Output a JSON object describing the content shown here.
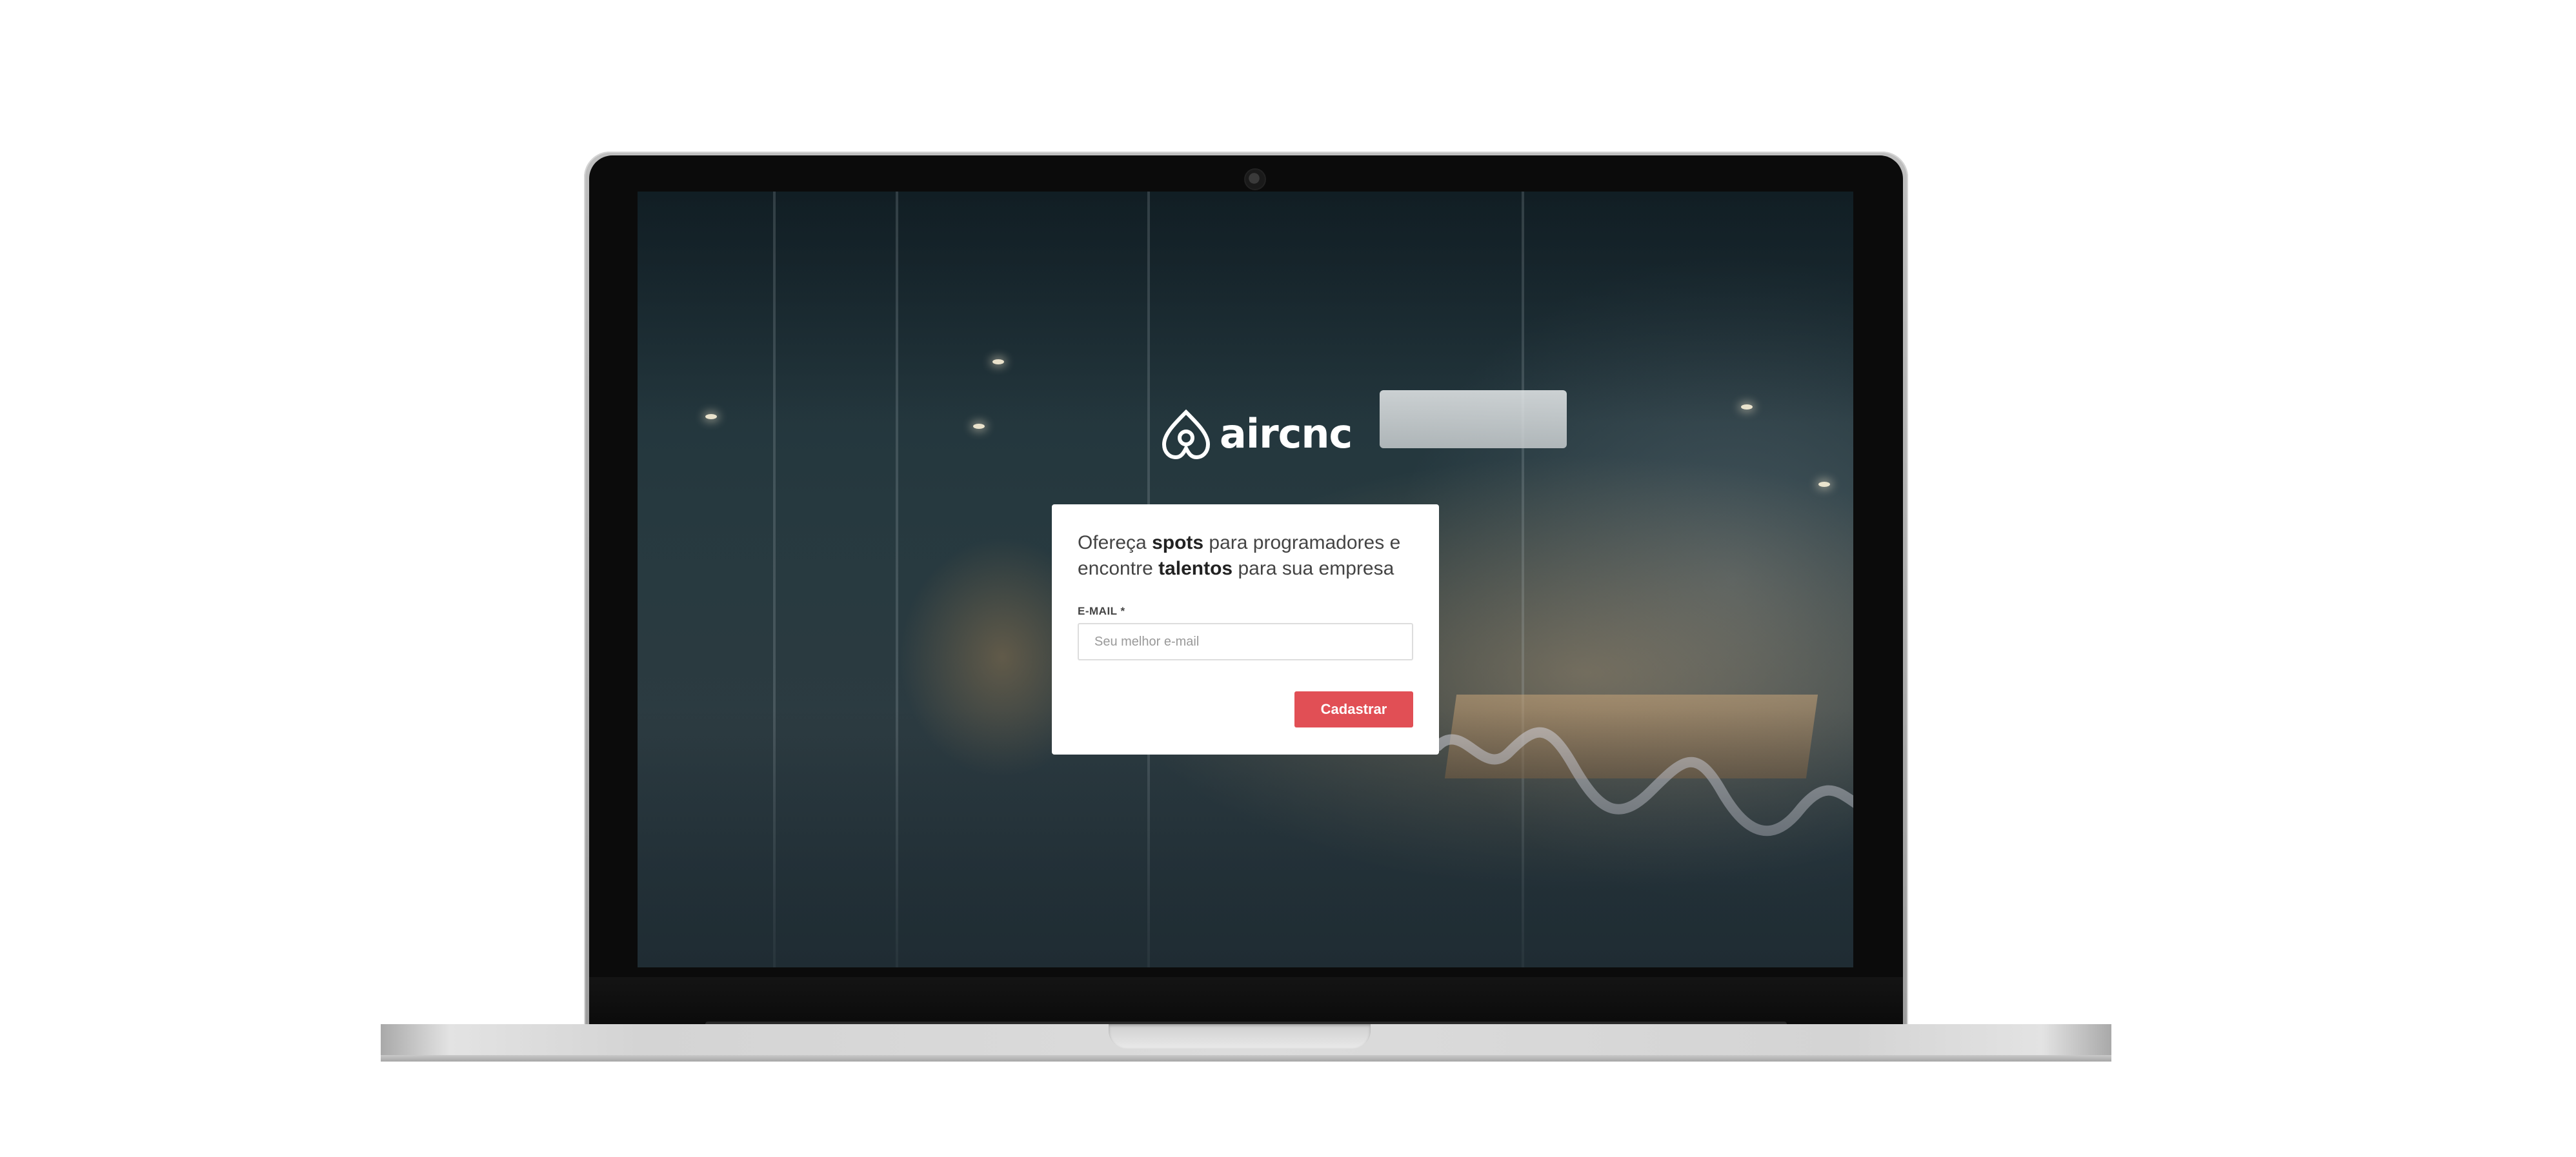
{
  "brand": {
    "name": "aircnc",
    "logo_icon": "airbnb-belo-icon",
    "text_color": "#ffffff"
  },
  "signup_card": {
    "headline": {
      "part1": "Ofereça ",
      "strong1": "spots",
      "part2": " para programadores e encontre ",
      "strong2": "talentos",
      "part3": " para sua empresa"
    },
    "email_label": "E-MAIL *",
    "email_placeholder": "Seu melhor e-mail",
    "email_value": "",
    "submit_label": "Cadastrar",
    "accent_color": "#e14f55"
  },
  "device": {
    "type": "laptop-mockup",
    "camera_icon": "webcam-icon"
  }
}
